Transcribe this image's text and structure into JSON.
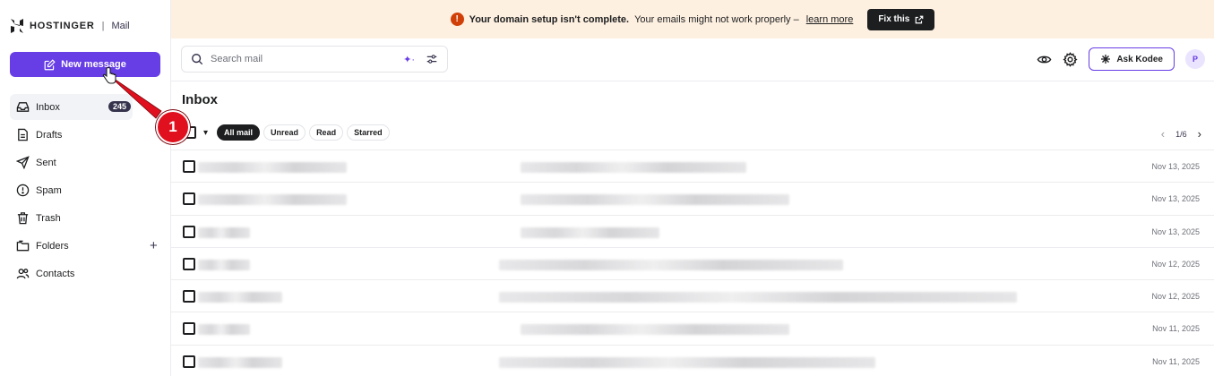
{
  "brand": {
    "name": "HOSTINGER",
    "separator": "|",
    "product": "Mail"
  },
  "sidebar": {
    "new_message_label": "New message",
    "items": [
      {
        "label": "Inbox",
        "icon": "inbox-icon",
        "badge": "245",
        "active": true
      },
      {
        "label": "Drafts",
        "icon": "draft-icon"
      },
      {
        "label": "Sent",
        "icon": "send-icon"
      },
      {
        "label": "Spam",
        "icon": "spam-icon"
      },
      {
        "label": "Trash",
        "icon": "trash-icon"
      },
      {
        "label": "Folders",
        "icon": "folder-icon",
        "action": "+"
      },
      {
        "label": "Contacts",
        "icon": "contacts-icon"
      }
    ]
  },
  "banner": {
    "icon": "!",
    "bold_text": "Your domain setup isn't complete.",
    "text": "Your emails might not work properly –",
    "link_text": "learn more",
    "button_label": "Fix this"
  },
  "search": {
    "placeholder": "Search mail"
  },
  "toolbar": {
    "ask_label": "Ask Kodee",
    "avatar_initial": "P"
  },
  "inbox": {
    "title": "Inbox",
    "filters": [
      "All mail",
      "Unread",
      "Read",
      "Starred"
    ],
    "active_filter": "All mail",
    "pagination": "1/6",
    "rows": [
      {
        "date": "Nov 13, 2025"
      },
      {
        "date": "Nov 13, 2025"
      },
      {
        "date": "Nov 13, 2025"
      },
      {
        "date": "Nov 12, 2025"
      },
      {
        "date": "Nov 12, 2025"
      },
      {
        "date": "Nov 11, 2025"
      },
      {
        "date": "Nov 11, 2025"
      }
    ]
  },
  "callout": {
    "number": "1"
  },
  "colors": {
    "accent": "#673de6",
    "banner_bg": "#fdf0e0",
    "warning": "#d13f08",
    "callout": "#e0101e"
  }
}
